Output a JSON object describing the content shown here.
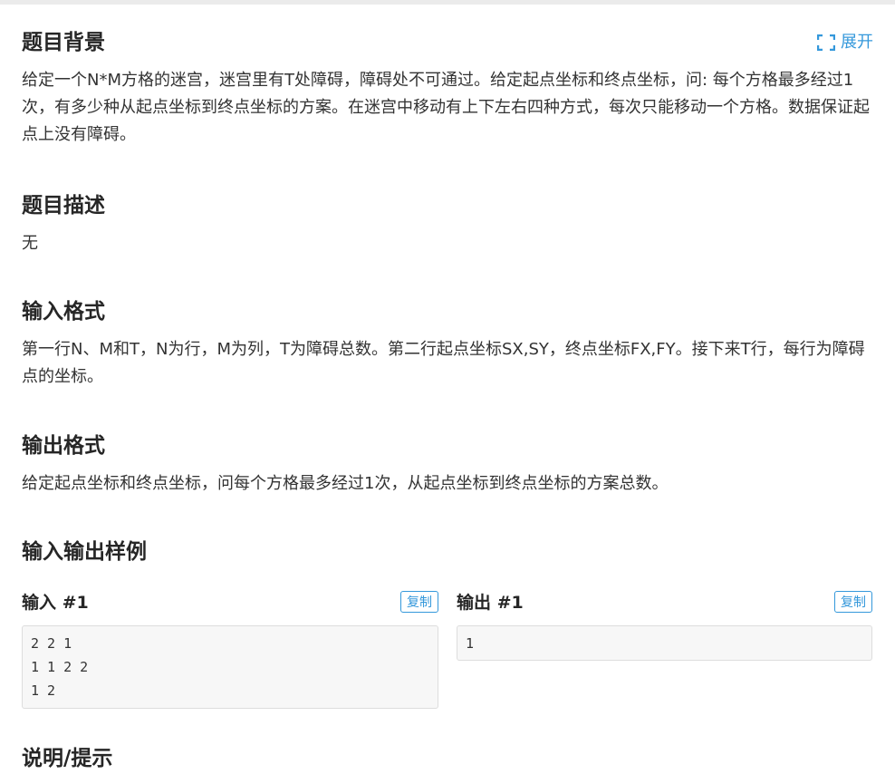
{
  "expand_label": "展开",
  "sections": {
    "background": {
      "title": "题目背景",
      "body": "给定一个N*M方格的迷宫，迷宫里有T处障碍，障碍处不可通过。给定起点坐标和终点坐标，问: 每个方格最多经过1次，有多少种从起点坐标到终点坐标的方案。在迷宫中移动有上下左右四种方式，每次只能移动一个方格。数据保证起点上没有障碍。"
    },
    "description": {
      "title": "题目描述",
      "body": "无"
    },
    "input_format": {
      "title": "输入格式",
      "body": "第一行N、M和T，N为行，M为列，T为障碍总数。第二行起点坐标SX,SY，终点坐标FX,FY。接下来T行，每行为障碍点的坐标。"
    },
    "output_format": {
      "title": "输出格式",
      "body": "给定起点坐标和终点坐标，问每个方格最多经过1次，从起点坐标到终点坐标的方案总数。"
    },
    "samples": {
      "title": "输入输出样例"
    },
    "hint": {
      "title": "说明/提示"
    }
  },
  "samples": {
    "input": {
      "title": "输入 #1",
      "copy_label": "复制",
      "content": "2 2 1\n1 1 2 2\n1 2"
    },
    "output": {
      "title": "输出 #1",
      "copy_label": "复制",
      "content": "1"
    }
  },
  "colors": {
    "accent": "#3498db",
    "code_bg": "#f7f7f7",
    "text": "#262626"
  }
}
